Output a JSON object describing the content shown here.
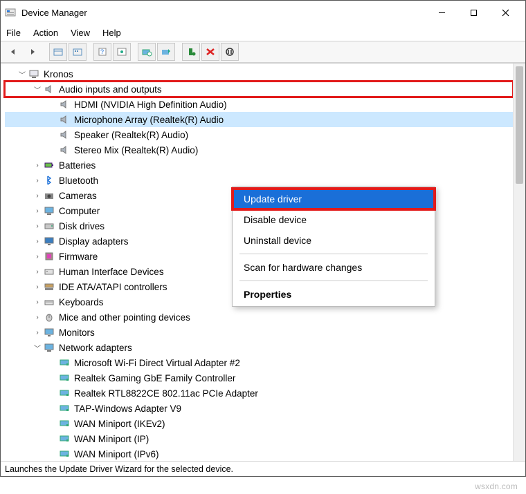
{
  "window": {
    "title": "Device Manager"
  },
  "menu": {
    "file": "File",
    "action": "Action",
    "view": "View",
    "help": "Help"
  },
  "tree": {
    "root": "Kronos",
    "audio_cat": "Audio inputs and outputs",
    "audio": {
      "a0": "HDMI (NVIDIA High Definition Audio)",
      "a1": "Microphone Array (Realtek(R) Audio",
      "a2": "Speaker (Realtek(R) Audio)",
      "a3": "Stereo Mix (Realtek(R) Audio)"
    },
    "c_batt": "Batteries",
    "c_bt": "Bluetooth",
    "c_cam": "Cameras",
    "c_comp": "Computer",
    "c_disk": "Disk drives",
    "c_disp": "Display adapters",
    "c_fw": "Firmware",
    "c_hid": "Human Interface Devices",
    "c_ide": "IDE ATA/ATAPI controllers",
    "c_kb": "Keyboards",
    "c_mouse": "Mice and other pointing devices",
    "c_mon": "Monitors",
    "c_net": "Network adapters",
    "net": {
      "n0": "Microsoft Wi-Fi Direct Virtual Adapter #2",
      "n1": "Realtek Gaming GbE Family Controller",
      "n2": "Realtek RTL8822CE 802.11ac PCIe Adapter",
      "n3": "TAP-Windows Adapter V9",
      "n4": "WAN Miniport (IKEv2)",
      "n5": "WAN Miniport (IP)",
      "n6": "WAN Miniport (IPv6)"
    }
  },
  "context": {
    "update": "Update driver",
    "disable": "Disable device",
    "uninstall": "Uninstall device",
    "scan": "Scan for hardware changes",
    "props": "Properties"
  },
  "status": "Launches the Update Driver Wizard for the selected device.",
  "watermark": "wsxdn.com"
}
